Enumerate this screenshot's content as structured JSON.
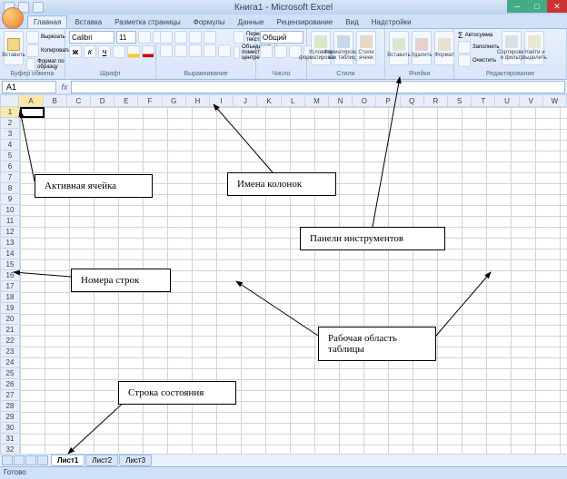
{
  "window": {
    "title": "Книга1 - Microsoft Excel"
  },
  "ribbon_tabs": [
    "Главная",
    "Вставка",
    "Разметка страницы",
    "Формулы",
    "Данные",
    "Рецензирование",
    "Вид",
    "Надстройки"
  ],
  "ribbon_groups": {
    "clipboard": {
      "label": "Буфер обмена",
      "cut": "Вырезать",
      "copy": "Копировать",
      "format_painter": "Формат по образцу",
      "paste": "Вставить"
    },
    "font": {
      "label": "Шрифт",
      "family": "Calibri",
      "size": "11"
    },
    "alignment": {
      "label": "Выравнивание",
      "wrap": "Перенос текста",
      "merge": "Объединить и поместить в центре"
    },
    "number": {
      "label": "Число",
      "format": "Общий"
    },
    "styles": {
      "label": "Стили",
      "cond": "Условное форматирование",
      "table": "Форматировать как таблицу",
      "cell": "Стили ячеек"
    },
    "cells": {
      "label": "Ячейки",
      "insert": "Вставить",
      "delete": "Удалить",
      "format": "Формат"
    },
    "editing": {
      "label": "Редактирование",
      "sum": "Автосумма",
      "fill": "Заполнить",
      "clear": "Очистить",
      "sort": "Сортировка и фильтр",
      "find": "Найти и выделить"
    }
  },
  "name_box": "A1",
  "columns": [
    "A",
    "B",
    "C",
    "D",
    "E",
    "F",
    "G",
    "H",
    "I",
    "J",
    "K",
    "L",
    "M",
    "N",
    "O",
    "P",
    "Q",
    "R",
    "S",
    "T",
    "U",
    "V",
    "W"
  ],
  "rows_count": 34,
  "sheets": [
    "Лист1",
    "Лист2",
    "Лист3"
  ],
  "status": "Готово",
  "annotations": {
    "active_cell": "Активная ячейка",
    "column_names": "Имена колонок",
    "toolbars": "Панели инструментов",
    "row_numbers": "Номера строк",
    "worksheet_area": "Рабочая область таблицы",
    "status_bar": "Строка состояния"
  }
}
